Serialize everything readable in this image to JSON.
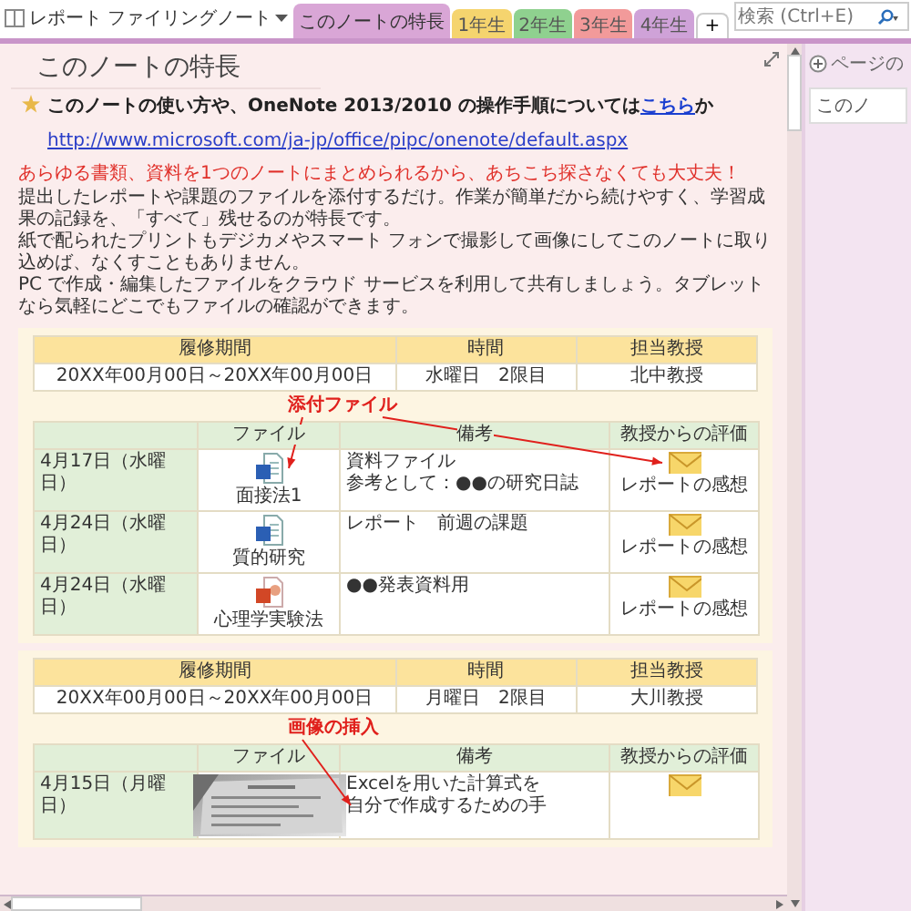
{
  "notebook": {
    "title": "レポート ファイリングノート"
  },
  "section_tabs": [
    {
      "label": "このノートの特長",
      "selected": true,
      "color": "#d9a6d6"
    },
    {
      "label": "1年生",
      "selected": false,
      "color": "#f5d46e"
    },
    {
      "label": "2年生",
      "selected": false,
      "color": "#8fd18f"
    },
    {
      "label": "3年生",
      "selected": false,
      "color": "#f29a9a"
    },
    {
      "label": "4年生",
      "selected": false,
      "color": "#cfa2d8"
    }
  ],
  "add_tab": "+",
  "search": {
    "placeholder": "検索 (Ctrl+E)"
  },
  "page": {
    "title": "このノートの特長",
    "note": {
      "before": "このノートの使い方や、OneNote 2013/2010 の操作手順については",
      "link": "こちら",
      "after": "か"
    },
    "url": "http://www.microsoft.com/ja-jp/office/pipc/onenote/default.aspx",
    "heading": "あらゆる書類、資料を1つのノートにまとめられるから、あちこち探さなくても大丈夫！",
    "paragraphs": [
      "提出したレポートや課題のファイルを添付するだけ。作業が簡単だから続けやすく、学習成果の記録を、「すべて」残せるのが特長です。",
      "紙で配られたプリントもデジカメやスマート フォンで撮影して画像にしてこのノートに取り込めば、なくすこともありません。",
      "PC で作成・編集したファイルをクラウド サービスを利用して共有しましょう。タブレットなら気軽にどこでもファイルの確認ができます。"
    ],
    "courses": [
      {
        "info_columns": [
          "履修期間",
          "時間",
          "担当教授"
        ],
        "info_values": [
          "20XX年00月00日～20XX年00月00日",
          "水曜日　2限目",
          "北中教授"
        ],
        "annotation": "添付ファイル",
        "columns": [
          "ファイル",
          "備考",
          "教授からの評価"
        ],
        "sessions": [
          {
            "date": "4月17日（水曜日）",
            "file": {
              "kind": "word",
              "name": "面接法1"
            },
            "notes": [
              "資料ファイル",
              "参考として：●●の研究日誌"
            ],
            "evaluation": "レポートの感想"
          },
          {
            "date": "4月24日（水曜日）",
            "file": {
              "kind": "word",
              "name": "質的研究"
            },
            "notes": [
              "レポート　前週の課題"
            ],
            "evaluation": "レポートの感想"
          },
          {
            "date": "4月24日（水曜日）",
            "file": {
              "kind": "slides",
              "name": "心理学実験法"
            },
            "notes": [
              "●●発表資料用"
            ],
            "evaluation": "レポートの感想"
          }
        ]
      },
      {
        "info_columns": [
          "履修期間",
          "時間",
          "担当教授"
        ],
        "info_values": [
          "20XX年00月00日～20XX年00月00日",
          "月曜日　2限目",
          "大川教授"
        ],
        "annotation": "画像の挿入",
        "columns": [
          "ファイル",
          "備考",
          "教授からの評価"
        ],
        "sessions": [
          {
            "date": "4月15日（月曜日）",
            "file": {
              "kind": "picture"
            },
            "notes": [
              "Excelを用いた計算式を",
              "自分で作成するための手"
            ]
          }
        ]
      }
    ]
  },
  "page_list": {
    "add_page": "ページの",
    "pages": [
      {
        "label": "このノ",
        "selected": true
      }
    ]
  }
}
